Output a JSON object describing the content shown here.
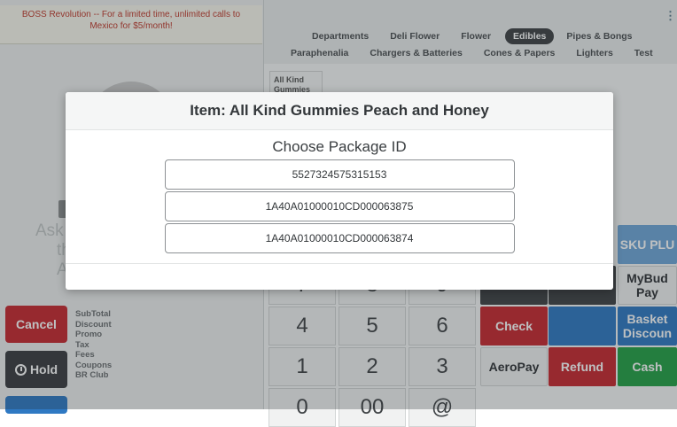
{
  "promo": {
    "text": "BOSS Revolution -- For a limited time, unlimited calls to Mexico for $5/month!"
  },
  "left": {
    "ask_text": "Ask",
    "ask_extra_1": "th",
    "ask_extra_2": "A",
    "cancel_label": "Cancel",
    "hold_label": "Hold",
    "totals": [
      "SubTotal",
      "Discount",
      "Promo",
      "Tax",
      "Fees",
      "Coupons",
      "BR Club"
    ]
  },
  "nav": {
    "row1": [
      "Departments",
      "Deli Flower",
      "Flower",
      "Edibles",
      "Pipes & Bongs"
    ],
    "row1_active": "Edibles",
    "row2": [
      "Paraphenalia",
      "Chargers & Batteries",
      "Cones & Papers",
      "Lighters",
      "Test"
    ]
  },
  "product_tile": {
    "label": "All Kind Gummies"
  },
  "keypad": {
    "row_top": [
      "7",
      "8",
      "9"
    ],
    "row1": [
      "4",
      "5",
      "6"
    ],
    "row2": [
      "1",
      "2",
      "3"
    ],
    "row3": [
      "0",
      "00",
      "@"
    ]
  },
  "right_keys": {
    "sku_plu": "SKU PLU",
    "mybud_pay": "MyBud Pay",
    "check": "Check",
    "basket_discount": "Basket Discoun",
    "aeropay": "AeroPay",
    "refund": "Refund",
    "cash": "Cash"
  },
  "modal": {
    "title": "Item: All Kind Gummies Peach and Honey",
    "subtitle": "Choose Package ID",
    "packages": [
      "5527324575315153",
      "1A40A01000010CD000063875",
      "1A40A01000010CD000063874"
    ]
  }
}
